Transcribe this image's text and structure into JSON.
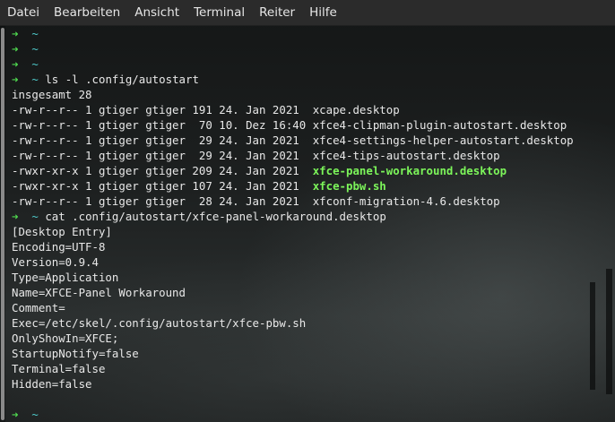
{
  "menu": [
    "Datei",
    "Bearbeiten",
    "Ansicht",
    "Terminal",
    "Reiter",
    "Hilfe"
  ],
  "prompt": {
    "arrow": "➜",
    "dir": "~"
  },
  "lines": [
    {
      "type": "prompt",
      "cmd": ""
    },
    {
      "type": "prompt",
      "cmd": ""
    },
    {
      "type": "prompt",
      "cmd": ""
    },
    {
      "type": "prompt",
      "cmd": "ls -l .config/autostart"
    },
    {
      "type": "text",
      "text": "insgesamt 28"
    },
    {
      "type": "file",
      "meta": "-rw-r--r-- 1 gtiger gtiger 191 24. Jan 2021  ",
      "name": "xcape.desktop",
      "exec": false
    },
    {
      "type": "file",
      "meta": "-rw-r--r-- 1 gtiger gtiger  70 10. Dez 16:40 ",
      "name": "xfce4-clipman-plugin-autostart.desktop",
      "exec": false
    },
    {
      "type": "file",
      "meta": "-rw-r--r-- 1 gtiger gtiger  29 24. Jan 2021  ",
      "name": "xfce4-settings-helper-autostart.desktop",
      "exec": false
    },
    {
      "type": "file",
      "meta": "-rw-r--r-- 1 gtiger gtiger  29 24. Jan 2021  ",
      "name": "xfce4-tips-autostart.desktop",
      "exec": false
    },
    {
      "type": "file",
      "meta": "-rwxr-xr-x 1 gtiger gtiger 209 24. Jan 2021  ",
      "name": "xfce-panel-workaround.desktop",
      "exec": true
    },
    {
      "type": "file",
      "meta": "-rwxr-xr-x 1 gtiger gtiger 107 24. Jan 2021  ",
      "name": "xfce-pbw.sh",
      "exec": true
    },
    {
      "type": "file",
      "meta": "-rw-r--r-- 1 gtiger gtiger  28 24. Jan 2021  ",
      "name": "xfconf-migration-4.6.desktop",
      "exec": false
    },
    {
      "type": "prompt",
      "cmd": "cat .config/autostart/xfce-panel-workaround.desktop"
    },
    {
      "type": "text",
      "text": "[Desktop Entry]"
    },
    {
      "type": "text",
      "text": "Encoding=UTF-8"
    },
    {
      "type": "text",
      "text": "Version=0.9.4"
    },
    {
      "type": "text",
      "text": "Type=Application"
    },
    {
      "type": "text",
      "text": "Name=XFCE-Panel Workaround"
    },
    {
      "type": "text",
      "text": "Comment="
    },
    {
      "type": "text",
      "text": "Exec=/etc/skel/.config/autostart/xfce-pbw.sh"
    },
    {
      "type": "text",
      "text": "OnlyShowIn=XFCE;"
    },
    {
      "type": "text",
      "text": "StartupNotify=false"
    },
    {
      "type": "text",
      "text": "Terminal=false"
    },
    {
      "type": "text",
      "text": "Hidden=false"
    },
    {
      "type": "text",
      "text": ""
    },
    {
      "type": "prompt",
      "cmd": ""
    }
  ]
}
